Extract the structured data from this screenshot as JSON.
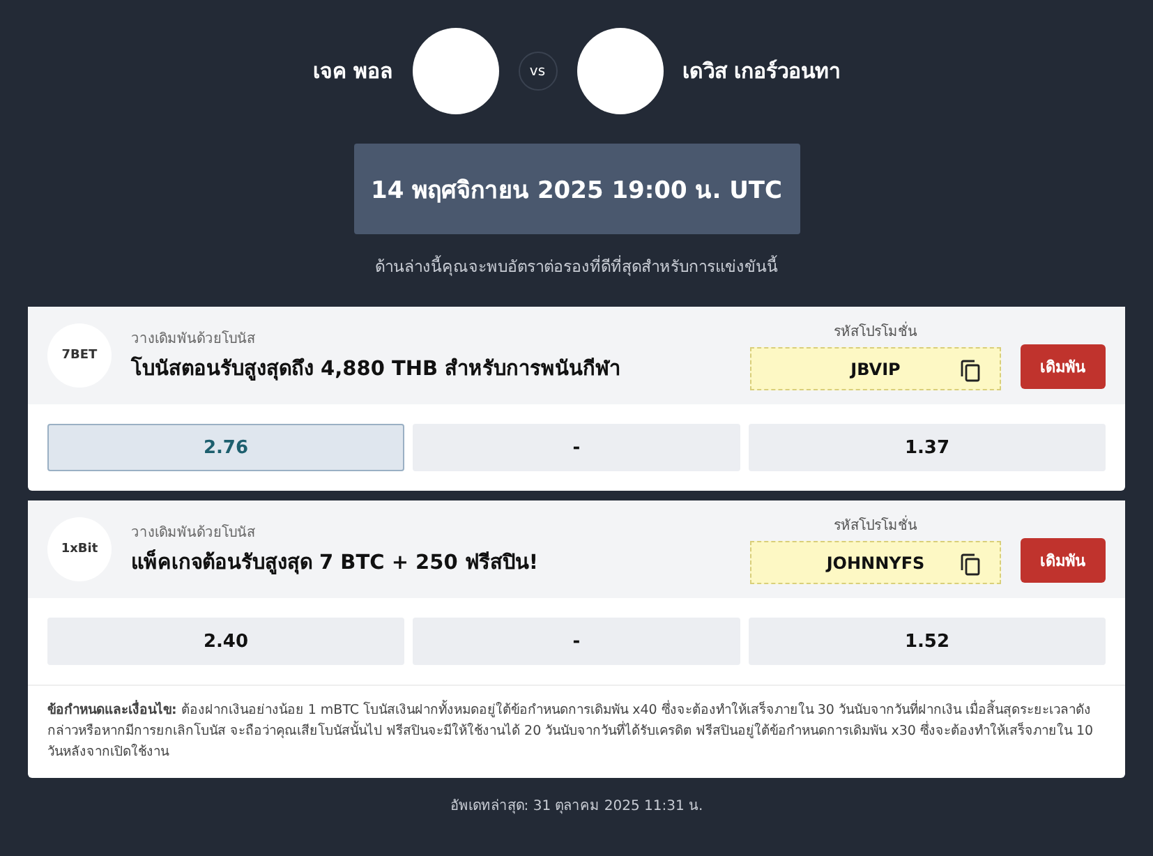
{
  "match": {
    "home": "เจค พอล",
    "vs": "vs",
    "away": "เดวิส เกอร์วอนทา",
    "datetime": "14 พฤศจิกายน 2025 19:00 น. UTC",
    "subtitle": "ด้านล่างนี้คุณจะพบอัตราต่อรองที่ดีที่สุดสำหรับการแข่งขันนี้"
  },
  "offers": [
    {
      "logo": "7BET",
      "label": "วางเดิมพันด้วยโบนัส",
      "title": "โบนัสตอนรับสูงสุดถึง 4,880 THB สำหรับการพนันกีฬา",
      "promo_label": "รหัสโปรโมชั่น",
      "code": "JBVIP",
      "button": "เดิมพัน",
      "odds": [
        {
          "value": "2.76",
          "selected": true
        },
        {
          "value": "-",
          "selected": false
        },
        {
          "value": "1.37",
          "selected": false
        }
      ]
    },
    {
      "logo": "1xBit",
      "label": "วางเดิมพันด้วยโบนัส",
      "title": "แพ็คเกจต้อนรับสูงสุด 7 BTC + 250 ฟรีสปิน!",
      "promo_label": "รหัสโปรโมชั่น",
      "code": "JOHNNYFS",
      "button": "เดิมพัน",
      "odds": [
        {
          "value": "2.40",
          "selected": false
        },
        {
          "value": "-",
          "selected": false
        },
        {
          "value": "1.52",
          "selected": false
        }
      ],
      "terms": "**ข้อกำหนดและเงื่อนไข:** ต้องฝากเงินอย่างน้อย 1 mBTC โบนัสเงินฝากทั้งหมดอยู่ใต้ข้อกำหนดการเดิมพัน x40 ซึ่งจะต้องทำให้เสร็จภายใน 30 วันนับจากวันที่ฝากเงิน เมื่อสิ้นสุดระยะเวลาดังกล่าวหรือหากมีการยกเลิกโบนัส จะถือว่าคุณเสียโบนัสนั้นไป ฟรีสปินจะมีให้ใช้งานได้ 20 วันนับจากวันที่ได้รับเครดิต ฟรีสปินอยู่ใต้ข้อกำหนดการเดิมพัน x30 ซึ่งจะต้องทำให้เสร็จภายใน 10 วันหลังจากเปิดใช้งาน"
    }
  ],
  "updated": "อัพเดทล่าสุด: 31 ตุลาคม 2025 11:31 น."
}
